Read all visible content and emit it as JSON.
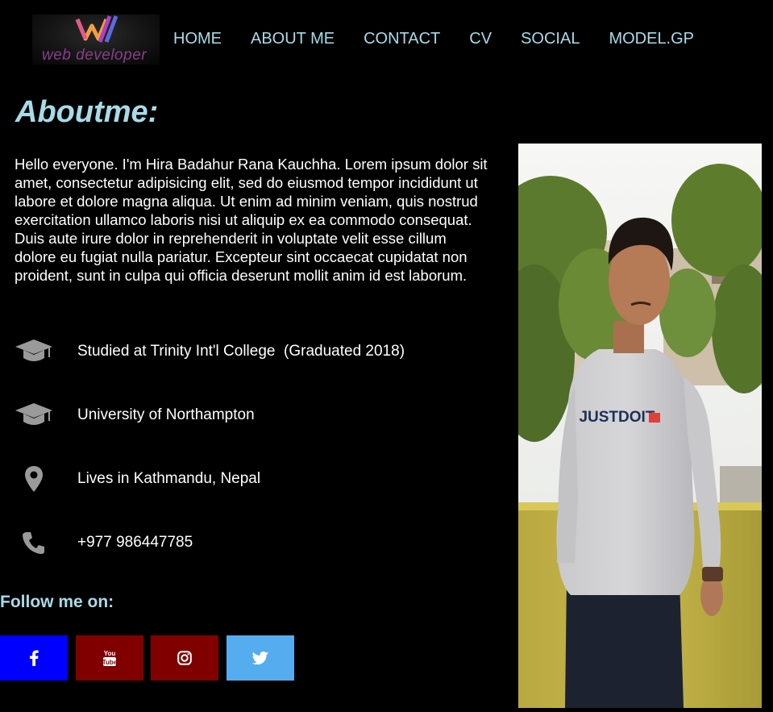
{
  "logo": {
    "text": "web developer",
    "colors": [
      "#e05a8a",
      "#f0a040",
      "#5a6ae0",
      "#b040c0"
    ]
  },
  "nav": {
    "items": [
      {
        "label": "HOME"
      },
      {
        "label": "ABOUT ME"
      },
      {
        "label": "CONTACT"
      },
      {
        "label": "CV"
      },
      {
        "label": "SOCIAL"
      },
      {
        "label": "MODEL.GP"
      }
    ]
  },
  "about": {
    "title": "Aboutme:",
    "intro": "Hello everyone. I'm Hira Badahur Rana Kauchha. Lorem ipsum dolor sit amet, consectetur adipisicing elit, sed do eiusmod tempor incididunt ut labore et dolore magna aliqua. Ut enim ad minim veniam, quis nostrud exercitation ullamco laboris nisi ut aliquip ex ea commodo consequat. Duis aute irure dolor in reprehenderit in voluptate velit esse cillum dolore eu fugiat nulla pariatur. Excepteur sint occaecat cupidatat non proident, sunt in culpa qui officia deserunt mollit anim id est laborum."
  },
  "info": [
    {
      "icon": "graduation-cap-icon",
      "text": "Studied at Trinity Int'l College  (Graduated 2018)"
    },
    {
      "icon": "graduation-cap-icon",
      "text": "University of Northampton"
    },
    {
      "icon": "map-marker-icon",
      "text": "Lives in Kathmandu, Nepal"
    },
    {
      "icon": "phone-icon",
      "text": "+977 986447785"
    }
  ],
  "follow": {
    "title": "Follow me on:",
    "buttons": [
      {
        "icon": "facebook-icon",
        "color": "#0000ff"
      },
      {
        "icon": "youtube-icon",
        "color": "#800000"
      },
      {
        "icon": "instagram-icon",
        "color": "#800000"
      },
      {
        "icon": "twitter-icon",
        "color": "#55acee"
      }
    ]
  },
  "photo": {
    "shirt_text": "JUSTDOIT."
  },
  "colors": {
    "background": "#000000",
    "accent": "#a8dbe8",
    "text": "#ffffff",
    "icon_gray": "#9a9a9a"
  }
}
